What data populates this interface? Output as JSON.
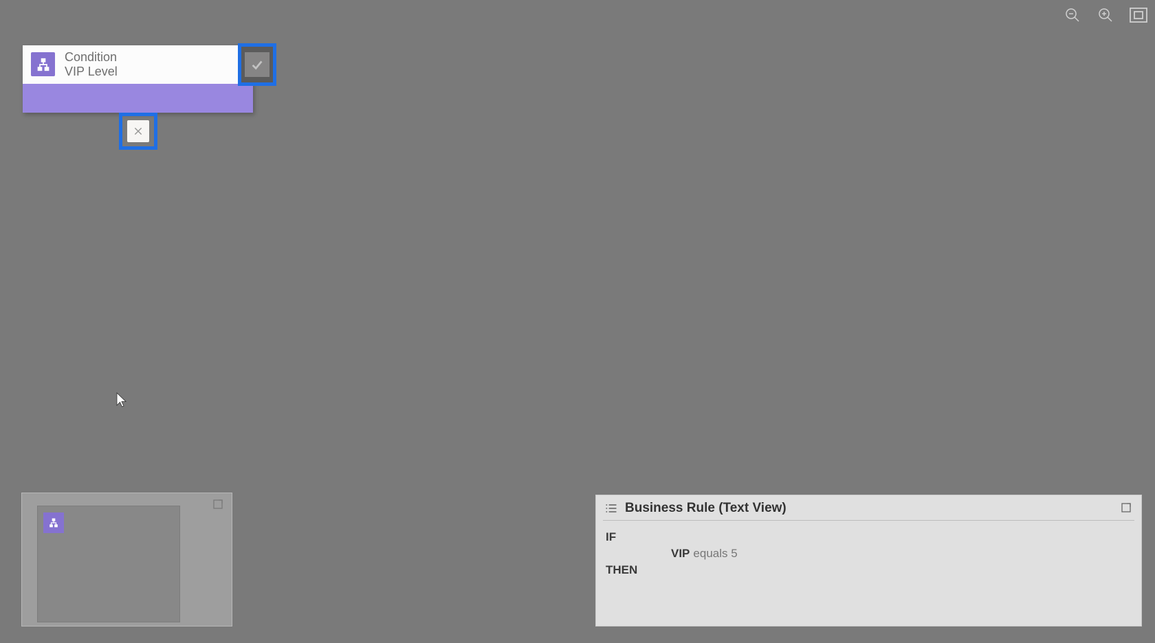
{
  "toolbar": {
    "zoom_out": "zoom-out",
    "zoom_in": "zoom-in",
    "fit": "fit-to-screen"
  },
  "condition_node": {
    "type_label": "Condition",
    "name": "VIP Level"
  },
  "textview": {
    "title": "Business Rule (Text View)",
    "if_label": "IF",
    "then_label": "THEN",
    "condition_field": "VIP",
    "condition_operator": "equals",
    "condition_value": "5"
  }
}
